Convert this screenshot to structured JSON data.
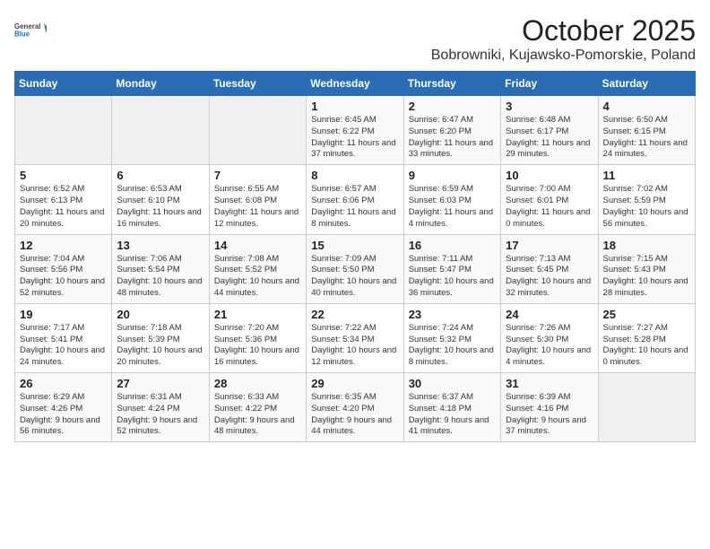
{
  "logo": {
    "general": "General",
    "blue": "Blue"
  },
  "title": "October 2025",
  "subtitle": "Bobrowniki, Kujawsko-Pomorskie, Poland",
  "days_of_week": [
    "Sunday",
    "Monday",
    "Tuesday",
    "Wednesday",
    "Thursday",
    "Friday",
    "Saturday"
  ],
  "weeks": [
    [
      {
        "day": null
      },
      {
        "day": null
      },
      {
        "day": null
      },
      {
        "day": "1",
        "sunrise": "Sunrise: 6:45 AM",
        "sunset": "Sunset: 6:22 PM",
        "daylight": "Daylight: 11 hours and 37 minutes."
      },
      {
        "day": "2",
        "sunrise": "Sunrise: 6:47 AM",
        "sunset": "Sunset: 6:20 PM",
        "daylight": "Daylight: 11 hours and 33 minutes."
      },
      {
        "day": "3",
        "sunrise": "Sunrise: 6:48 AM",
        "sunset": "Sunset: 6:17 PM",
        "daylight": "Daylight: 11 hours and 29 minutes."
      },
      {
        "day": "4",
        "sunrise": "Sunrise: 6:50 AM",
        "sunset": "Sunset: 6:15 PM",
        "daylight": "Daylight: 11 hours and 24 minutes."
      }
    ],
    [
      {
        "day": "5",
        "sunrise": "Sunrise: 6:52 AM",
        "sunset": "Sunset: 6:13 PM",
        "daylight": "Daylight: 11 hours and 20 minutes."
      },
      {
        "day": "6",
        "sunrise": "Sunrise: 6:53 AM",
        "sunset": "Sunset: 6:10 PM",
        "daylight": "Daylight: 11 hours and 16 minutes."
      },
      {
        "day": "7",
        "sunrise": "Sunrise: 6:55 AM",
        "sunset": "Sunset: 6:08 PM",
        "daylight": "Daylight: 11 hours and 12 minutes."
      },
      {
        "day": "8",
        "sunrise": "Sunrise: 6:57 AM",
        "sunset": "Sunset: 6:06 PM",
        "daylight": "Daylight: 11 hours and 8 minutes."
      },
      {
        "day": "9",
        "sunrise": "Sunrise: 6:59 AM",
        "sunset": "Sunset: 6:03 PM",
        "daylight": "Daylight: 11 hours and 4 minutes."
      },
      {
        "day": "10",
        "sunrise": "Sunrise: 7:00 AM",
        "sunset": "Sunset: 6:01 PM",
        "daylight": "Daylight: 11 hours and 0 minutes."
      },
      {
        "day": "11",
        "sunrise": "Sunrise: 7:02 AM",
        "sunset": "Sunset: 5:59 PM",
        "daylight": "Daylight: 10 hours and 56 minutes."
      }
    ],
    [
      {
        "day": "12",
        "sunrise": "Sunrise: 7:04 AM",
        "sunset": "Sunset: 5:56 PM",
        "daylight": "Daylight: 10 hours and 52 minutes."
      },
      {
        "day": "13",
        "sunrise": "Sunrise: 7:06 AM",
        "sunset": "Sunset: 5:54 PM",
        "daylight": "Daylight: 10 hours and 48 minutes."
      },
      {
        "day": "14",
        "sunrise": "Sunrise: 7:08 AM",
        "sunset": "Sunset: 5:52 PM",
        "daylight": "Daylight: 10 hours and 44 minutes."
      },
      {
        "day": "15",
        "sunrise": "Sunrise: 7:09 AM",
        "sunset": "Sunset: 5:50 PM",
        "daylight": "Daylight: 10 hours and 40 minutes."
      },
      {
        "day": "16",
        "sunrise": "Sunrise: 7:11 AM",
        "sunset": "Sunset: 5:47 PM",
        "daylight": "Daylight: 10 hours and 36 minutes."
      },
      {
        "day": "17",
        "sunrise": "Sunrise: 7:13 AM",
        "sunset": "Sunset: 5:45 PM",
        "daylight": "Daylight: 10 hours and 32 minutes."
      },
      {
        "day": "18",
        "sunrise": "Sunrise: 7:15 AM",
        "sunset": "Sunset: 5:43 PM",
        "daylight": "Daylight: 10 hours and 28 minutes."
      }
    ],
    [
      {
        "day": "19",
        "sunrise": "Sunrise: 7:17 AM",
        "sunset": "Sunset: 5:41 PM",
        "daylight": "Daylight: 10 hours and 24 minutes."
      },
      {
        "day": "20",
        "sunrise": "Sunrise: 7:18 AM",
        "sunset": "Sunset: 5:39 PM",
        "daylight": "Daylight: 10 hours and 20 minutes."
      },
      {
        "day": "21",
        "sunrise": "Sunrise: 7:20 AM",
        "sunset": "Sunset: 5:36 PM",
        "daylight": "Daylight: 10 hours and 16 minutes."
      },
      {
        "day": "22",
        "sunrise": "Sunrise: 7:22 AM",
        "sunset": "Sunset: 5:34 PM",
        "daylight": "Daylight: 10 hours and 12 minutes."
      },
      {
        "day": "23",
        "sunrise": "Sunrise: 7:24 AM",
        "sunset": "Sunset: 5:32 PM",
        "daylight": "Daylight: 10 hours and 8 minutes."
      },
      {
        "day": "24",
        "sunrise": "Sunrise: 7:26 AM",
        "sunset": "Sunset: 5:30 PM",
        "daylight": "Daylight: 10 hours and 4 minutes."
      },
      {
        "day": "25",
        "sunrise": "Sunrise: 7:27 AM",
        "sunset": "Sunset: 5:28 PM",
        "daylight": "Daylight: 10 hours and 0 minutes."
      }
    ],
    [
      {
        "day": "26",
        "sunrise": "Sunrise: 6:29 AM",
        "sunset": "Sunset: 4:26 PM",
        "daylight": "Daylight: 9 hours and 56 minutes."
      },
      {
        "day": "27",
        "sunrise": "Sunrise: 6:31 AM",
        "sunset": "Sunset: 4:24 PM",
        "daylight": "Daylight: 9 hours and 52 minutes."
      },
      {
        "day": "28",
        "sunrise": "Sunrise: 6:33 AM",
        "sunset": "Sunset: 4:22 PM",
        "daylight": "Daylight: 9 hours and 48 minutes."
      },
      {
        "day": "29",
        "sunrise": "Sunrise: 6:35 AM",
        "sunset": "Sunset: 4:20 PM",
        "daylight": "Daylight: 9 hours and 44 minutes."
      },
      {
        "day": "30",
        "sunrise": "Sunrise: 6:37 AM",
        "sunset": "Sunset: 4:18 PM",
        "daylight": "Daylight: 9 hours and 41 minutes."
      },
      {
        "day": "31",
        "sunrise": "Sunrise: 6:39 AM",
        "sunset": "Sunset: 4:16 PM",
        "daylight": "Daylight: 9 hours and 37 minutes."
      },
      {
        "day": null
      }
    ]
  ]
}
